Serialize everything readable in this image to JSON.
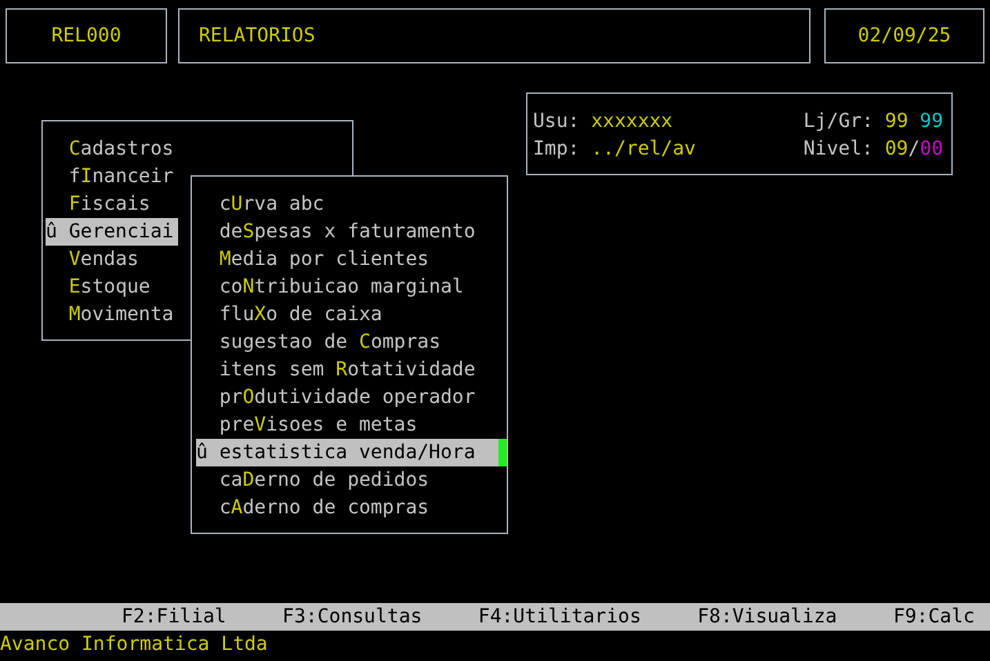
{
  "header": {
    "program_code": "REL000",
    "title": "RELATORIOS",
    "date": "02/09/25"
  },
  "info": {
    "user_label": "Usu:",
    "user": "xxxxxxx",
    "printer_label": "Imp:",
    "printer": "../rel/av",
    "store_label": "Lj/Gr:",
    "store": "99",
    "group": "99",
    "nivel_label": "Nivel:",
    "nivel": "09",
    "separator": "/",
    "subnivel": "00"
  },
  "main_menu": [
    {
      "key": "C",
      "after": "adastros",
      "selected": false
    },
    {
      "before": "f",
      "key": "I",
      "after": "nanceir",
      "selected": false
    },
    {
      "key": "F",
      "after": "iscais",
      "selected": false
    },
    {
      "before": "Gerenciai",
      "selected": true,
      "marker": "û"
    },
    {
      "key": "V",
      "after": "endas",
      "selected": false
    },
    {
      "key": "E",
      "after": "stoque",
      "selected": false
    },
    {
      "key": "M",
      "after": "ovimenta",
      "selected": false
    }
  ],
  "submenu": [
    {
      "before": "c",
      "key": "U",
      "after": "rva abc",
      "selected": false
    },
    {
      "before": "de",
      "key": "S",
      "after": "pesas x faturamento",
      "selected": false
    },
    {
      "key": "M",
      "after": "edia por clientes",
      "selected": false
    },
    {
      "before": "co",
      "key": "N",
      "after": "tribuicao marginal",
      "selected": false
    },
    {
      "before": "flu",
      "key": "X",
      "after": "o de caixa",
      "selected": false
    },
    {
      "before": "sugestao de ",
      "key": "C",
      "after": "ompras",
      "selected": false
    },
    {
      "before": "itens sem ",
      "key": "R",
      "after": "otatividade",
      "selected": false
    },
    {
      "before": "pr",
      "key": "O",
      "after": "dutividade operador",
      "selected": false
    },
    {
      "before": "pre",
      "key": "V",
      "after": "isoes e metas",
      "selected": false
    },
    {
      "before": "estatistica venda/Hora",
      "selected": true,
      "marker": "û"
    },
    {
      "before": "ca",
      "key": "D",
      "after": "erno de pedidos",
      "selected": false
    },
    {
      "before": "c",
      "key": "A",
      "after": "derno de compras",
      "selected": false
    }
  ],
  "function_keys": [
    "F2:Filial",
    "F3:Consultas",
    "F4:Utilitarios",
    "F8:Visualiza",
    "F9:Calc"
  ],
  "footer": "Avanco Informatica Ltda"
}
